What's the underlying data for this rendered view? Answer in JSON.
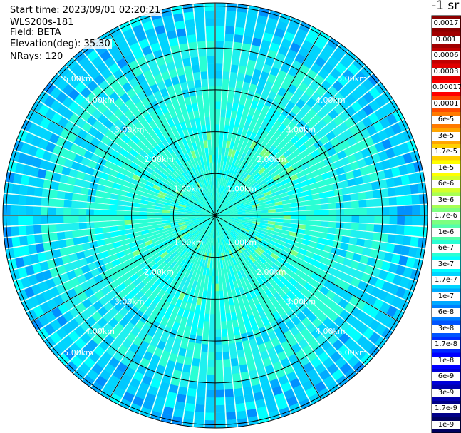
{
  "info": {
    "start_time": "Start time: 2023/09/01 02:20:21",
    "instrument": "WLS200s-181",
    "field": "Field: BETA",
    "elevation": "Elevation(deg): 35.30",
    "nrays": "NRays: 120"
  },
  "colorbar": {
    "units": "-1 sr",
    "labels": [
      "0.0017",
      "0.001",
      "0.0006",
      "0.0003",
      "0.00017",
      "0.0001",
      "6e-5",
      "3e-5",
      "1.7e-5",
      "1e-5",
      "6e-6",
      "3e-6",
      "1.7e-6",
      "1e-6",
      "6e-7",
      "3e-7",
      "1.7e-7",
      "1e-7",
      "6e-8",
      "3e-8",
      "1.7e-8",
      "1e-8",
      "6e-9",
      "3e-9",
      "1.7e-9",
      "1e-9"
    ],
    "colors": [
      "#8b0000",
      "#a00000",
      "#c00000",
      "#e00000",
      "#ff0000",
      "#ff4a00",
      "#ff7a00",
      "#ffa500",
      "#ffd000",
      "#ffff00",
      "#d4ff2a",
      "#a8ff55",
      "#7dff80",
      "#55ffaa",
      "#2affd4",
      "#00ffff",
      "#00d4ff",
      "#00aaff",
      "#0080ff",
      "#0055ff",
      "#002aff",
      "#0000ff",
      "#0000d8",
      "#0000b0",
      "#000088",
      "#000060"
    ]
  },
  "chart_data": {
    "type": "heatmap",
    "projection": "polar (PPI scan)",
    "field": "BETA",
    "units": "-1 sr",
    "elevation_deg": 35.3,
    "n_rays": 120,
    "range_rings_km": [
      1,
      2,
      3,
      4,
      5
    ],
    "range_ring_labels": [
      "1.00km",
      "2.00km",
      "3.00km",
      "4.00km",
      "5.00km"
    ],
    "spokes_deg": [
      0,
      30,
      60,
      90,
      120,
      150,
      180,
      210,
      240,
      270,
      300,
      330
    ],
    "max_range_km": 5.0,
    "dominant_value_range": [
      "3e-7",
      "1e-7"
    ],
    "outer_edge_values": [
      "6e-8",
      "1.7e-8"
    ]
  }
}
